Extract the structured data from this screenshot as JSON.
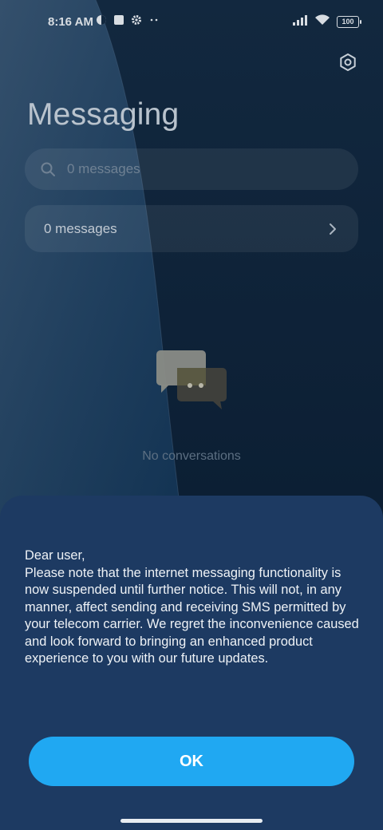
{
  "status_bar": {
    "time": "8:16 AM",
    "battery": "100",
    "icons_left": [
      "app-circle-icon",
      "square-app-icon",
      "settings-gear-small-icon",
      "more-dots-icon"
    ],
    "icons_right": [
      "signal-icon",
      "wifi-icon",
      "battery-icon"
    ]
  },
  "header": {
    "title": "Messaging",
    "settings_icon": "settings-hex-icon"
  },
  "search": {
    "placeholder": "0 messages",
    "value": ""
  },
  "messages_row": {
    "label": "0 messages"
  },
  "empty_state": {
    "label": "No conversations",
    "icon": "chat-bubbles-icon"
  },
  "notice": {
    "text": "Dear user,\nPlease note that the internet messaging functionality is now suspended until further notice. This will not, in any manner, affect sending and receiving SMS permitted by your telecom carrier. We regret the inconvenience caused and look forward to bringing an enhanced product experience to you with our future updates."
  },
  "actions": {
    "ok_label": "OK"
  },
  "colors": {
    "sheet_background": "#1d3a62",
    "ok_button": "#20a8f2",
    "page_background": "#0d2238"
  }
}
